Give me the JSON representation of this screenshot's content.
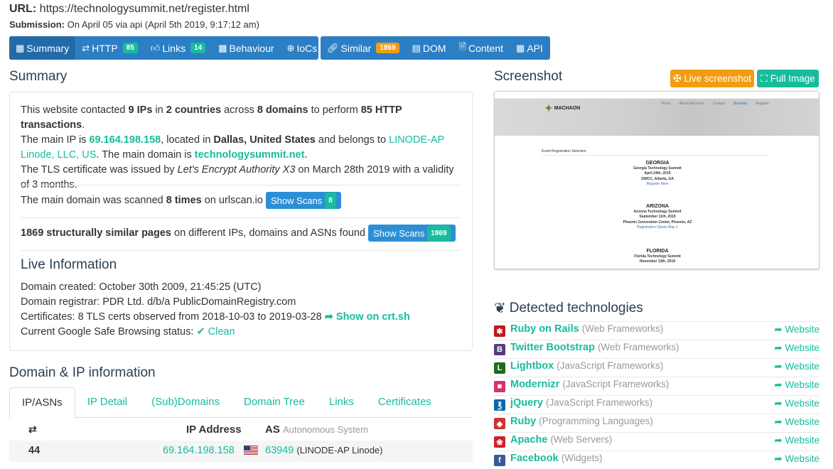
{
  "header": {
    "url_label": "URL:",
    "url": "https://technologysummit.net/register.html",
    "submission_label": "Submission:",
    "submission": "On April 05 via api (April 5th 2019, 9:17:12 am)"
  },
  "nav": {
    "summary": "Summary",
    "http": "HTTP",
    "http_count": "85",
    "links": "Links",
    "links_count": "14",
    "behaviour": "Behaviour",
    "iocs": "IoCs",
    "similar": "Similar",
    "similar_count": "1869",
    "dom": "DOM",
    "content": "Content",
    "api": "API"
  },
  "summary": {
    "title": "Summary",
    "p1_a": "This website contacted ",
    "p1_ips": "9 IPs",
    "p1_b": " in ",
    "p1_countries": "2 countries",
    "p1_c": " across ",
    "p1_domains": "8 domains",
    "p1_d": " to perform ",
    "p1_tx": "85 HTTP transactions",
    "p1_e": ".",
    "p2_a": "The main IP is ",
    "main_ip": "69.164.198.158",
    "p2_b": ", located in ",
    "location": "Dallas, United States",
    "p2_c": " and belongs to ",
    "asn_owner": "LINODE-AP Linode, LLC, US",
    "p2_d": ". The main domain is ",
    "main_domain": "technologysummit.net",
    "p2_e": ".",
    "p3_a": "The TLS certificate was issued by ",
    "issuer": "Let's Encrypt Authority X3",
    "p3_b": " on March 28th 2019 with a validity of 3 months.",
    "scanned_a": "The main domain was scanned ",
    "scanned_times": "8 times",
    "scanned_b": " on urlscan.io",
    "show_scans_label": "Show Scans",
    "show_scans_count": "8",
    "similar_bold": "1869 structurally similar pages",
    "similar_rest": " on different IPs, domains and ASNs found",
    "show_scans2_label": "Show Scans",
    "show_scans2_count": "1869",
    "live_title": "Live Information",
    "created": "Domain created: October 30th 2009, 21:45:25 (UTC)",
    "registrar": "Domain registrar: PDR Ltd. d/b/a PublicDomainRegistry.com",
    "certs": "Certificates: 8 TLS certs observed from 2018-10-03 to 2019-03-28",
    "crt_link": "Show on crt.sh",
    "safe_label": "Current Google Safe Browsing status:",
    "safe_status": "Clean"
  },
  "domain_ip": {
    "title": "Domain & IP information",
    "tabs": [
      "IP/ASNs",
      "IP Detail",
      "(Sub)Domains",
      "Domain Tree",
      "Links",
      "Certificates"
    ],
    "col_ip": "IP Address",
    "col_as": "AS",
    "col_as_sub": "Autonomous System",
    "rows": [
      {
        "count": "44",
        "ip": "69.164.198.158",
        "as_num": "63949",
        "as_name": "(LINODE-AP Linode)"
      }
    ]
  },
  "screenshot": {
    "title": "Screenshot",
    "live_btn": "Live screenshot",
    "full_btn": "Full Image",
    "site_logo": "MACHAON",
    "site_nav": [
      "Home",
      "About Machaon",
      "Contact",
      "Summits",
      "Register"
    ],
    "event_selection": "Event Registration Selection",
    "events": [
      {
        "logo": "GEORGIA",
        "name": "Georgia Technology Summit",
        "date": "April 24th, 2019",
        "venue": "GWCC, Atlanta, GA",
        "cta": "Register Here"
      },
      {
        "logo": "ARIZONA",
        "name": "Arizona Technology Summit",
        "date": "September 11th, 2019",
        "venue": "Phoenix Convention Center, Phoenix, AZ",
        "cta": "Registration Opens May 1"
      },
      {
        "logo": "FLORIDA",
        "name": "Florida Technology Summit",
        "date": "November 13th, 2019",
        "venue": "",
        "cta": ""
      }
    ]
  },
  "technologies": {
    "title": "Detected technologies",
    "website_label": "Website",
    "items": [
      {
        "name": "Ruby on Rails",
        "category": "(Web Frameworks)",
        "color": "#c5161d",
        "icon": "rails-icon"
      },
      {
        "name": "Twitter Bootstrap",
        "category": "(Web Frameworks)",
        "color": "#563d7c",
        "icon": "bootstrap-icon"
      },
      {
        "name": "Lightbox",
        "category": "(JavaScript Frameworks)",
        "color": "#1f6b1f",
        "icon": "lightbox-icon"
      },
      {
        "name": "Modernizr",
        "category": "(JavaScript Frameworks)",
        "color": "#d6336c",
        "icon": "modernizr-icon"
      },
      {
        "name": "jQuery",
        "category": "(JavaScript Frameworks)",
        "color": "#0769ad",
        "icon": "jquery-icon"
      },
      {
        "name": "Ruby",
        "category": "(Programming Languages)",
        "color": "#cc342d",
        "icon": "ruby-icon"
      },
      {
        "name": "Apache",
        "category": "(Web Servers)",
        "color": "#d22128",
        "icon": "apache-icon"
      },
      {
        "name": "Facebook",
        "category": "(Widgets)",
        "color": "#3b5998",
        "icon": "facebook-icon"
      }
    ]
  }
}
